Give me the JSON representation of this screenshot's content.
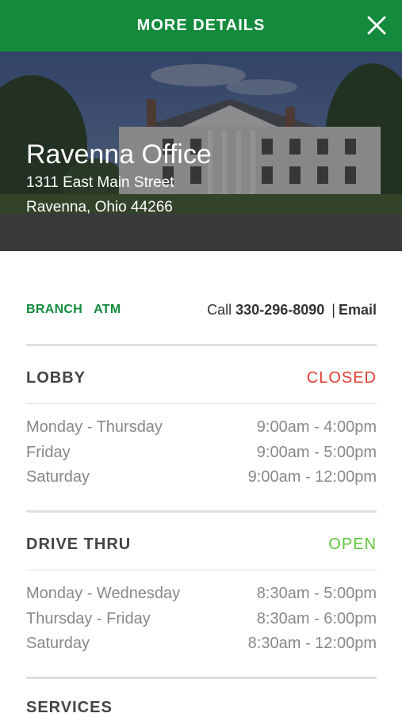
{
  "header": {
    "title": "MORE DETAILS"
  },
  "office": {
    "name": "Ravenna Office",
    "street": "1311 East Main Street",
    "city": "Ravenna, Ohio 44266"
  },
  "links": {
    "branch": "BRANCH",
    "atm": "ATM",
    "call_prefix": "Call",
    "phone": "330-296-8090",
    "separator": "|",
    "email": "Email"
  },
  "lobby": {
    "title": "LOBBY",
    "status": "CLOSED",
    "hours": [
      {
        "days": "Monday - Thursday",
        "time": "9:00am - 4:00pm"
      },
      {
        "days": "Friday",
        "time": "9:00am - 5:00pm"
      },
      {
        "days": "Saturday",
        "time": "9:00am - 12:00pm"
      }
    ]
  },
  "drive_thru": {
    "title": "DRIVE THRU",
    "status": "OPEN",
    "hours": [
      {
        "days": "Monday - Wednesday",
        "time": "8:30am - 5:00pm"
      },
      {
        "days": "Thursday - Friday",
        "time": "8:30am - 6:00pm"
      },
      {
        "days": "Saturday",
        "time": "8:30am - 12:00pm"
      }
    ]
  },
  "services": {
    "title": "SERVICES"
  },
  "colors": {
    "brand_green": "#138a3c",
    "closed_red": "#e03c2f",
    "open_green": "#5cc53b"
  },
  "icons": {
    "close": "close-icon"
  }
}
